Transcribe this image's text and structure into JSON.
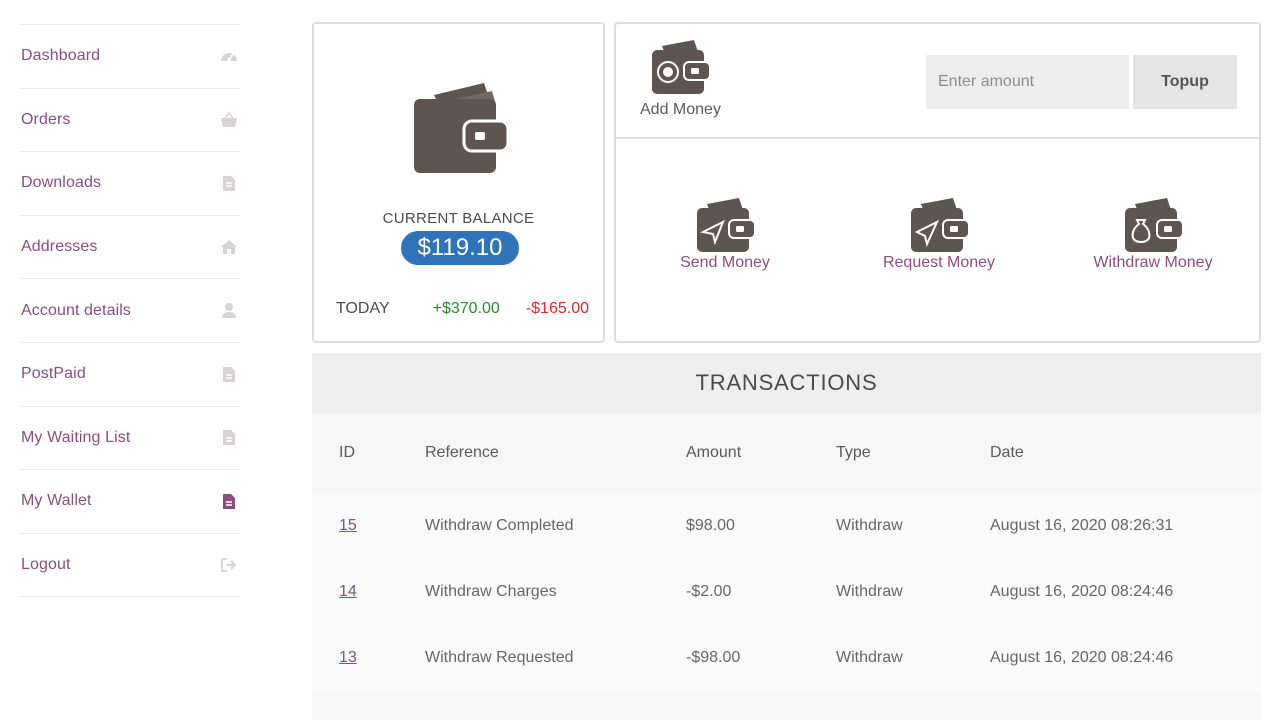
{
  "sidebar": {
    "items": [
      {
        "label": "Dashboard",
        "icon": "dashboard-gauge-icon"
      },
      {
        "label": "Orders",
        "icon": "basket-icon"
      },
      {
        "label": "Downloads",
        "icon": "file-download-icon"
      },
      {
        "label": "Addresses",
        "icon": "home-icon"
      },
      {
        "label": "Account details",
        "icon": "user-icon"
      },
      {
        "label": "PostPaid",
        "icon": "file-icon"
      },
      {
        "label": "My Waiting List",
        "icon": "file-icon"
      },
      {
        "label": "My Wallet",
        "icon": "file-icon",
        "active": true
      },
      {
        "label": "Logout",
        "icon": "sign-out-icon"
      }
    ]
  },
  "balance": {
    "label": "CURRENT BALANCE",
    "amount": "$119.10",
    "today_label": "TODAY",
    "today_credit": "+$370.00",
    "today_debit": "-$165.00"
  },
  "topup": {
    "add_money_label": "Add Money",
    "placeholder": "Enter amount",
    "button_label": "Topup"
  },
  "actions": [
    {
      "label": "Send Money",
      "icon": "send-money-wallet-icon"
    },
    {
      "label": "Request Money",
      "icon": "request-money-wallet-icon"
    },
    {
      "label": "Withdraw Money",
      "icon": "withdraw-money-wallet-icon"
    }
  ],
  "transactions": {
    "title": "TRANSACTIONS",
    "columns": [
      "ID",
      "Reference",
      "Amount",
      "Type",
      "Date"
    ],
    "rows": [
      {
        "id": "15",
        "reference": "Withdraw Completed",
        "amount": "$98.00",
        "type": "Withdraw",
        "date": "August 16, 2020 08:26:31"
      },
      {
        "id": "14",
        "reference": "Withdraw Charges",
        "amount": "-$2.00",
        "type": "Withdraw",
        "date": "August 16, 2020 08:24:46"
      },
      {
        "id": "13",
        "reference": "Withdraw Requested",
        "amount": "-$98.00",
        "type": "Withdraw",
        "date": "August 16, 2020 08:24:46"
      }
    ]
  },
  "colors": {
    "accent": "#8a4e7d",
    "balance_pill": "#2f73ba",
    "credit": "#2b8a2e",
    "debit": "#e0291f",
    "amount_blue": "#3333cc"
  }
}
